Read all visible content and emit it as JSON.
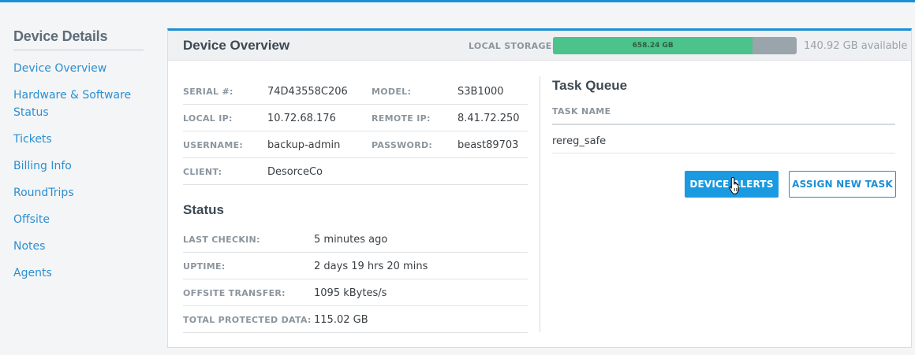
{
  "sidebar": {
    "title": "Device Details",
    "items": [
      {
        "label": "Device Overview"
      },
      {
        "label": "Hardware & Software Status"
      },
      {
        "label": "Tickets"
      },
      {
        "label": "Billing Info"
      },
      {
        "label": "RoundTrips"
      },
      {
        "label": "Offsite"
      },
      {
        "label": "Notes"
      },
      {
        "label": "Agents"
      }
    ]
  },
  "panel": {
    "title": "Device Overview",
    "storage": {
      "label": "LOCAL STORAGE:",
      "used": "658.24 GB",
      "used_fraction": 0.82,
      "available": "140.92 GB available",
      "used_color": "#4cc38a",
      "free_color": "#9aa4ab"
    }
  },
  "details": {
    "serial_label": "SERIAL #:",
    "serial": "74D43558C206",
    "model_label": "MODEL:",
    "model": "S3B1000",
    "local_ip_label": "LOCAL IP:",
    "local_ip": "10.72.68.176",
    "remote_ip_label": "REMOTE IP:",
    "remote_ip": "8.41.72.250",
    "username_label": "USERNAME:",
    "username": "backup-admin",
    "password_label": "PASSWORD:",
    "password": "beast89703",
    "client_label": "CLIENT:",
    "client": "DesorceCo"
  },
  "status": {
    "title": "Status",
    "rows": [
      {
        "label": "LAST CHECKIN:",
        "value": "5 minutes ago"
      },
      {
        "label": "UPTIME:",
        "value": "2 days 19 hrs 20 mins"
      },
      {
        "label": "OFFSITE TRANSFER:",
        "value": "1095 kBytes/s"
      },
      {
        "label": "TOTAL PROTECTED DATA:",
        "value": "115.02 GB"
      }
    ]
  },
  "task_queue": {
    "title": "Task Queue",
    "column": "TASK NAME",
    "tasks": [
      "rereg_safe"
    ],
    "buttons": {
      "alerts": "DEVICE ALERTS",
      "assign": "ASSIGN NEW TASK"
    }
  },
  "colors": {
    "accent": "#1a8fd6"
  }
}
